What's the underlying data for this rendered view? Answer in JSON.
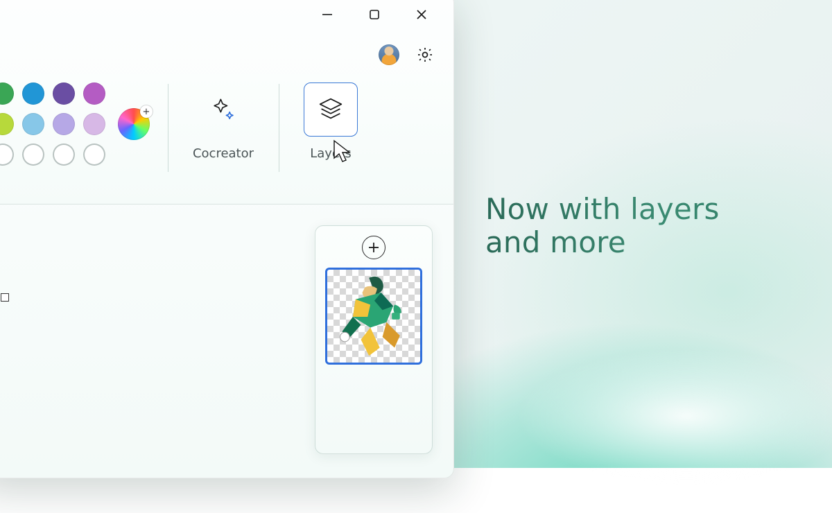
{
  "promo": {
    "headline": "Now with layers and more"
  },
  "window_controls": {
    "minimize_icon": "minimize",
    "maximize_icon": "maximize",
    "close_icon": "close"
  },
  "subbar": {
    "avatar_icon": "user-avatar",
    "settings_icon": "settings"
  },
  "ribbon": {
    "colors": {
      "swatches_row1": [
        "#3aa655",
        "#2196d6",
        "#6a4ea3",
        "#b45cc3"
      ],
      "swatches_row2": [
        "#b7d93b",
        "#87c7e8",
        "#b6a8e6",
        "#d7b8e6"
      ],
      "swatches_row3_empty_count": 4,
      "edit_colors_icon": "color-wheel"
    },
    "cocreator": {
      "label": "Cocreator",
      "icon": "sparkle"
    },
    "layers": {
      "label": "Layers",
      "icon": "layers-stack",
      "selected": true
    }
  },
  "layers_panel": {
    "add_icon": "plus",
    "selected_layer": {
      "description": "soccer player artwork",
      "selected": true
    }
  }
}
